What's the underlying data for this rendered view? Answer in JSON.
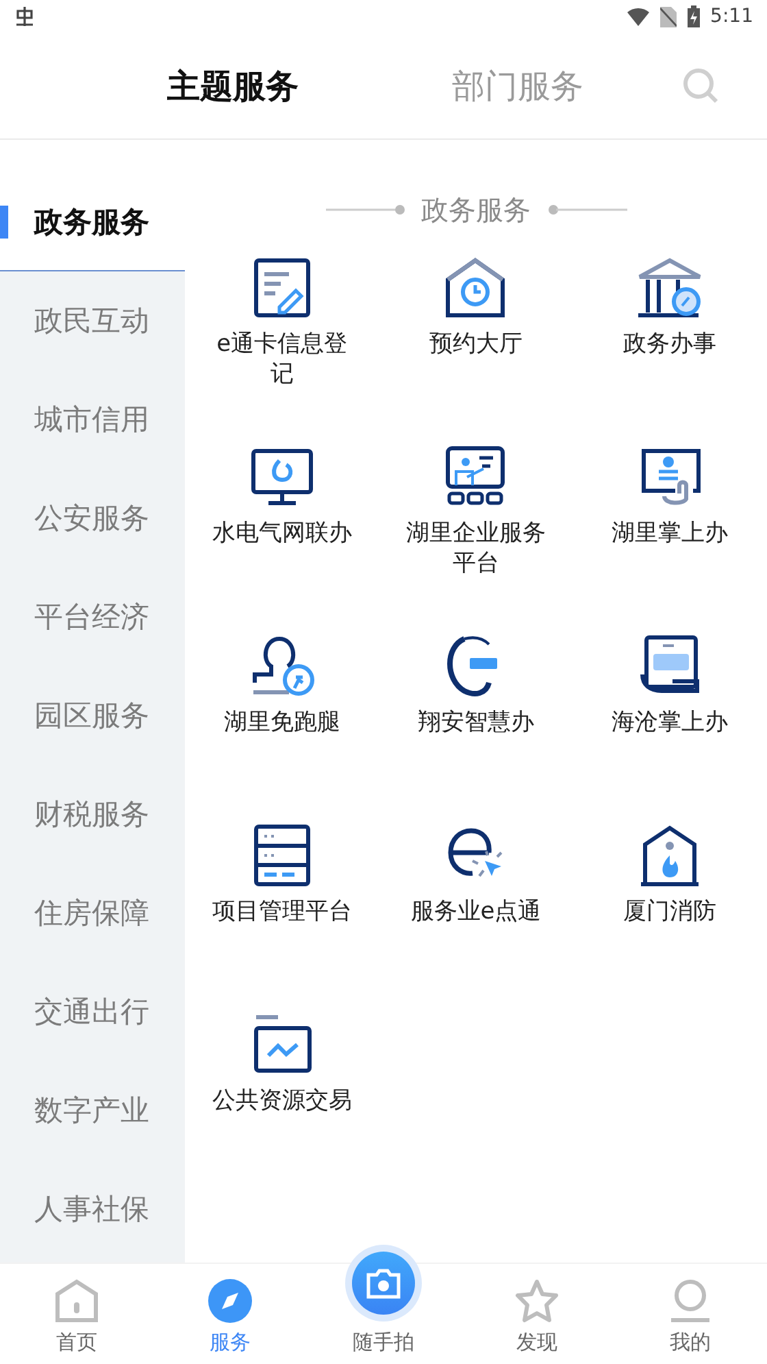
{
  "status_bar": {
    "time": "5:11"
  },
  "header": {
    "tabs": [
      {
        "label": "主题服务",
        "selected": true
      },
      {
        "label": "部门服务",
        "selected": false
      }
    ]
  },
  "sidebar": {
    "items": [
      {
        "label": "政务服务",
        "selected": true
      },
      {
        "label": "政民互动",
        "selected": false
      },
      {
        "label": "城市信用",
        "selected": false
      },
      {
        "label": "公安服务",
        "selected": false
      },
      {
        "label": "平台经济",
        "selected": false
      },
      {
        "label": "园区服务",
        "selected": false
      },
      {
        "label": "财税服务",
        "selected": false
      },
      {
        "label": "住房保障",
        "selected": false
      },
      {
        "label": "交通出行",
        "selected": false
      },
      {
        "label": "数字产业",
        "selected": false
      },
      {
        "label": "人事社保",
        "selected": false
      }
    ]
  },
  "section": {
    "title": "政务服务",
    "services": [
      {
        "label": "e通卡信息登记"
      },
      {
        "label": "预约大厅"
      },
      {
        "label": "政务办事"
      },
      {
        "label": "水电气网联办"
      },
      {
        "label": "湖里企业服务平台"
      },
      {
        "label": "湖里掌上办"
      },
      {
        "label": "湖里免跑腿"
      },
      {
        "label": "翔安智慧办"
      },
      {
        "label": "海沧掌上办"
      },
      {
        "label": "项目管理平台"
      },
      {
        "label": "服务业e点通"
      },
      {
        "label": "厦门消防"
      },
      {
        "label": "公共资源交易"
      }
    ]
  },
  "bottom_nav": [
    {
      "label": "首页",
      "kind": "tab",
      "selected": false
    },
    {
      "label": "服务",
      "kind": "tab",
      "selected": true
    },
    {
      "label": "随手拍",
      "kind": "camera",
      "selected": false
    },
    {
      "label": "发现",
      "kind": "tab",
      "selected": false
    },
    {
      "label": "我的",
      "kind": "tab",
      "selected": false
    }
  ]
}
